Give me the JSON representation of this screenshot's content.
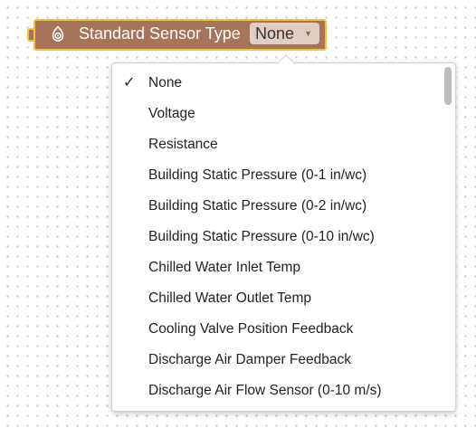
{
  "block": {
    "title": "Standard Sensor Type",
    "icon": "sensor-icon",
    "selected_value": "None",
    "dropdown_arrow": "▼"
  },
  "colors": {
    "block_fill": "#a5745b",
    "block_outline": "#f4c13b",
    "field_fill": "#e2cdc1"
  },
  "menu": {
    "check_mark": "✓",
    "items": [
      {
        "label": "None",
        "checked": true
      },
      {
        "label": "Voltage",
        "checked": false
      },
      {
        "label": "Resistance",
        "checked": false
      },
      {
        "label": "Building Static Pressure (0-1 in/wc)",
        "checked": false
      },
      {
        "label": "Building Static Pressure (0-2 in/wc)",
        "checked": false
      },
      {
        "label": "Building Static Pressure (0-10 in/wc)",
        "checked": false
      },
      {
        "label": "Chilled Water Inlet Temp",
        "checked": false
      },
      {
        "label": "Chilled Water Outlet Temp",
        "checked": false
      },
      {
        "label": "Cooling Valve Position Feedback",
        "checked": false
      },
      {
        "label": "Discharge Air Damper Feedback",
        "checked": false
      },
      {
        "label": "Discharge Air Flow Sensor (0-10 m/s)",
        "checked": false
      }
    ]
  }
}
